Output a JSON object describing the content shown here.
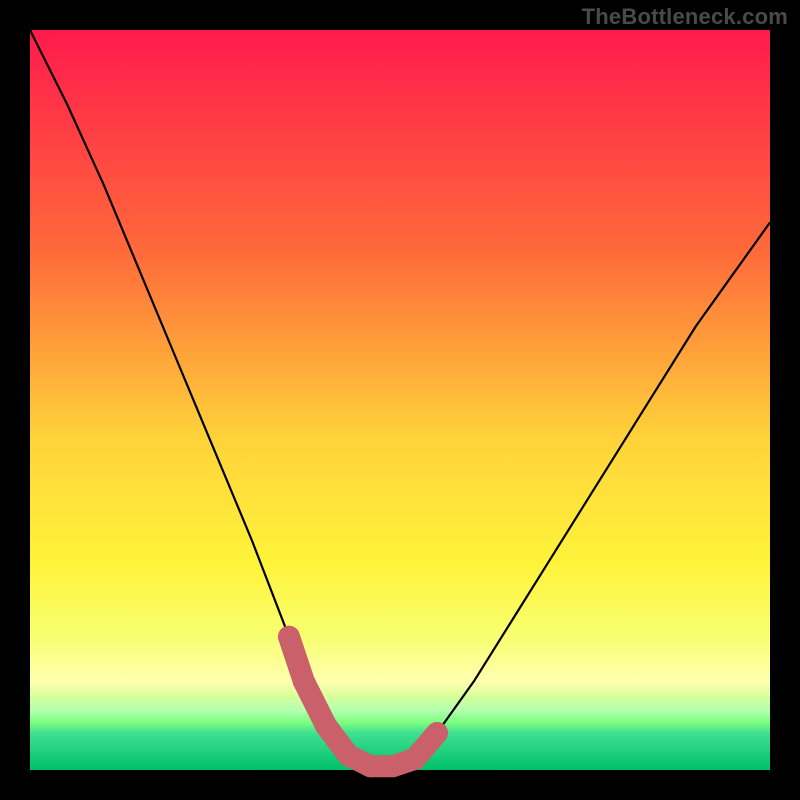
{
  "watermark": "TheBottleneck.com",
  "colors": {
    "frame": "#000000",
    "curve": "#000000",
    "marker": "#c9606a",
    "gradient_top": "#ff1a4d",
    "gradient_mid": "#ffd23a",
    "gradient_bottom": "#00c06a"
  },
  "chart_data": {
    "type": "line",
    "title": "",
    "xlabel": "",
    "ylabel": "",
    "xlim": [
      0,
      100
    ],
    "ylim": [
      0,
      100
    ],
    "grid": false,
    "series": [
      {
        "name": "curve",
        "x": [
          0,
          5,
          10,
          15,
          20,
          25,
          30,
          35,
          37,
          40,
          43,
          46,
          49,
          52,
          55,
          60,
          65,
          70,
          75,
          80,
          85,
          90,
          95,
          100
        ],
        "values": [
          100,
          90,
          79,
          67,
          55,
          43,
          31,
          18,
          12,
          6,
          2,
          0.5,
          0.5,
          1.5,
          5,
          12,
          20,
          28,
          36,
          44,
          52,
          60,
          67,
          74
        ]
      }
    ],
    "annotations": [
      {
        "name": "trough-markers",
        "color": "#c9606a",
        "points_x": [
          35,
          37,
          40,
          43,
          46,
          49,
          52,
          55
        ],
        "points_y": [
          18,
          12,
          6,
          2,
          0.5,
          0.5,
          1.5,
          5
        ]
      }
    ]
  }
}
